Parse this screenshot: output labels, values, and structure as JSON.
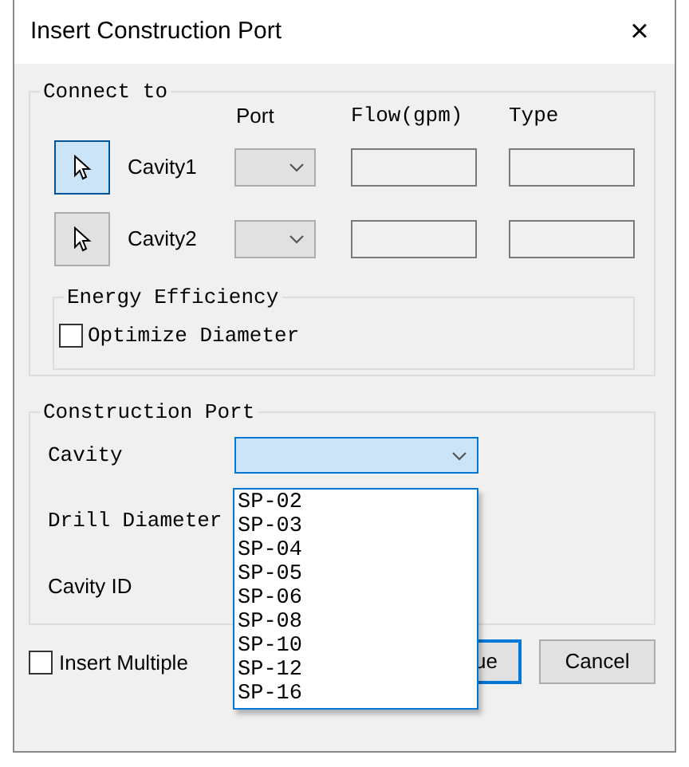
{
  "window": {
    "title": "Insert Construction Port",
    "close": "×"
  },
  "connect_group": {
    "title": "Connect to",
    "headers": [
      "Port",
      "Flow(gpm)",
      "Type"
    ],
    "rows": [
      {
        "label": "Cavity1",
        "selected": true
      },
      {
        "label": "Cavity2",
        "selected": false
      }
    ],
    "energy_group": {
      "title": "Energy Efficiency",
      "checkbox": {
        "label": "Optimize Diameter",
        "checked": false
      }
    }
  },
  "construction_group": {
    "title": "Construction Port",
    "fields": [
      {
        "label": "Cavity",
        "kind": "combo"
      },
      {
        "label": "Drill Diameter",
        "kind": "hidden"
      },
      {
        "label": "Cavity ID",
        "kind": "hidden"
      }
    ],
    "dropdown": {
      "expanded": true,
      "options": [
        "SP-02",
        "SP-03",
        "SP-04",
        "SP-05",
        "SP-06",
        "SP-08",
        "SP-10",
        "SP-12",
        "SP-16"
      ]
    }
  },
  "insert_multiple": {
    "label": "Insert Multiple",
    "checked": false
  },
  "buttons": [
    {
      "label": "ue",
      "kind": "default"
    },
    {
      "label": "Cancel",
      "kind": "normal"
    }
  ]
}
